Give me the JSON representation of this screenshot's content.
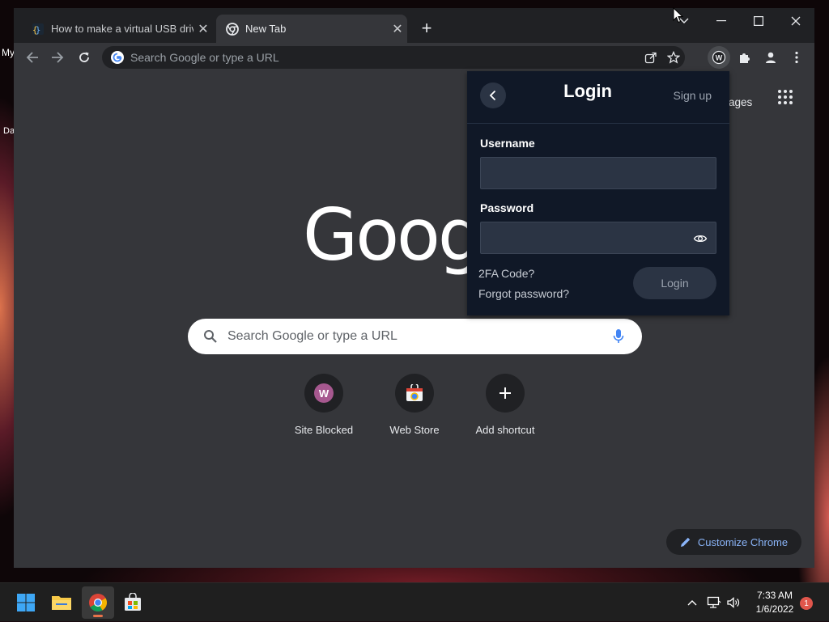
{
  "desktop": {
    "icon_label_1": "My",
    "icon_label_2": "Da"
  },
  "browser": {
    "tabs": [
      {
        "title": "How to make a virtual USB drive",
        "active": false,
        "favicon": "brackets-icon"
      },
      {
        "title": "New Tab",
        "active": true,
        "favicon": "chrome-icon"
      }
    ],
    "omnibox": {
      "placeholder": "Search Google or type a URL"
    },
    "toolbar_icons": [
      "back-icon",
      "forward-icon",
      "reload-icon",
      "share-icon",
      "star-icon",
      "extension-w-icon",
      "puzzle-icon",
      "profile-icon",
      "menu-icon"
    ]
  },
  "newtab": {
    "images_link": "Images",
    "logo_text": "Goog",
    "search_placeholder": "Search Google or type a URL",
    "shortcuts": [
      {
        "label": "Site Blocked",
        "icon": "letter-w-icon",
        "letter": "W"
      },
      {
        "label": "Web Store",
        "icon": "web-store-icon"
      },
      {
        "label": "Add shortcut",
        "icon": "plus-icon"
      }
    ],
    "customize_label": "Customize Chrome"
  },
  "popup": {
    "title": "Login",
    "signup": "Sign up",
    "username_label": "Username",
    "username_value": "",
    "password_label": "Password",
    "password_value": "",
    "twofa_link": "2FA Code?",
    "forgot_link": "Forgot password?",
    "login_button": "Login"
  },
  "taskbar": {
    "time": "7:33 AM",
    "date": "1/6/2022",
    "notification_count": "1"
  },
  "colors": {
    "accent": "#8ab4f8",
    "popup_bg": "#101827",
    "field_bg": "#2b3444",
    "browser_frame": "#202124",
    "content_bg": "#35363a"
  }
}
